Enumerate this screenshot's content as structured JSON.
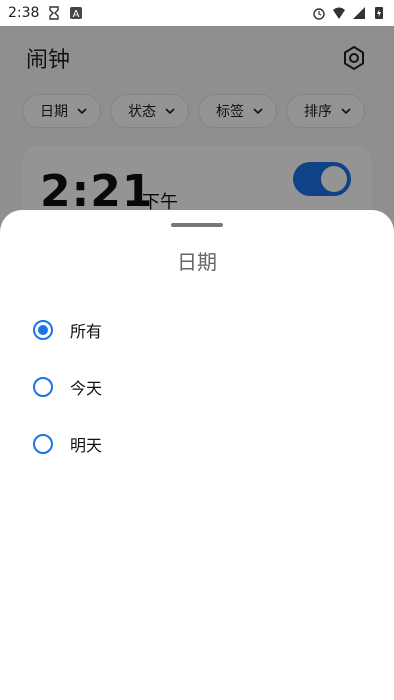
{
  "status_bar": {
    "time": "2:38",
    "icons": [
      "hourglass-icon",
      "app-a-icon",
      "alarm-icon",
      "wifi-icon",
      "signal-icon",
      "battery-charging-icon"
    ]
  },
  "app": {
    "title": "闹钟",
    "settings_icon": "gear-hexagon-icon",
    "filters": [
      {
        "label": "日期"
      },
      {
        "label": "状态"
      },
      {
        "label": "标签"
      },
      {
        "label": "排序"
      }
    ],
    "alarm": {
      "time": "2:21",
      "ampm": "下午",
      "enabled": true
    }
  },
  "sheet": {
    "title": "日期",
    "options": [
      {
        "label": "所有",
        "selected": true
      },
      {
        "label": "今天",
        "selected": false
      },
      {
        "label": "明天",
        "selected": false
      }
    ]
  },
  "colors": {
    "accent": "#1a73e8",
    "scrim": "rgba(0,0,0,0.42)"
  }
}
